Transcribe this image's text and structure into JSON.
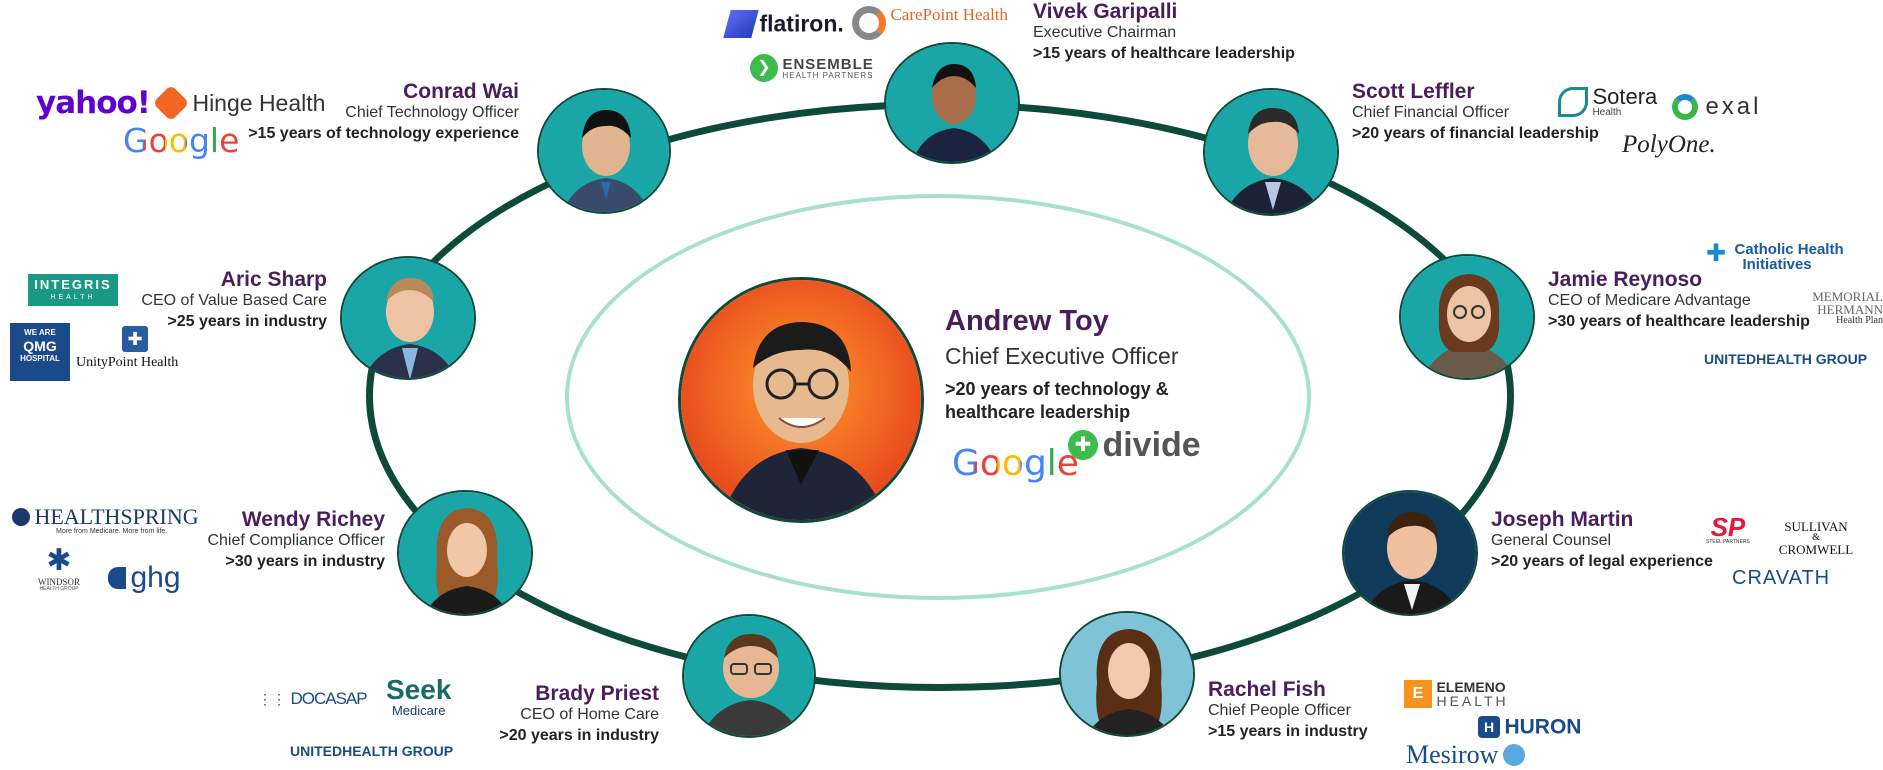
{
  "ceo": {
    "name": "Andrew Toy",
    "title": "Chief Executive Officer",
    "experience_line1": ">20 years of technology &",
    "experience_line2": "healthcare leadership",
    "logos": [
      "Google",
      "divide"
    ]
  },
  "people": [
    {
      "name": "Vivek Garipalli",
      "title": "Executive Chairman",
      "experience": ">15 years of healthcare leadership",
      "logos": [
        "flatiron.",
        "CarePoint Health",
        "ENSEMBLE",
        "HEALTH PARTNERS"
      ]
    },
    {
      "name": "Conrad Wai",
      "title": "Chief Technology Officer",
      "experience": ">15 years of technology experience",
      "logos": [
        "yahoo!",
        "Hinge Health",
        "Google"
      ]
    },
    {
      "name": "Scott Leffler",
      "title": "Chief Financial Officer",
      "experience": ">20 years of financial leadership",
      "logos": [
        "Sotera",
        "Health",
        "exal",
        "PolyOne."
      ]
    },
    {
      "name": "Aric Sharp",
      "title": "CEO of Value Based Care",
      "experience": ">25 years in industry",
      "logos": [
        "INTEGRIS",
        "HEALTH",
        "WE ARE",
        "QMG",
        "HOSPITAL",
        "UnityPoint Health"
      ]
    },
    {
      "name": "Jamie Reynoso",
      "title": "CEO of Medicare Advantage",
      "experience": ">30 years of healthcare leadership",
      "logos": [
        "Catholic Health",
        "Initiatives",
        "MEMORIAL",
        "HERMANN",
        "Health Plan",
        "UNITEDHEALTH GROUP"
      ]
    },
    {
      "name": "Wendy Richey",
      "title": "Chief Compliance Officer",
      "experience": ">30 years in industry",
      "logos": [
        "HEALTHSPRING",
        "More from Medicare. More from life.",
        "WINDSOR",
        "HEALTH GROUP",
        "ghg"
      ]
    },
    {
      "name": "Joseph Martin",
      "title": "General Counsel",
      "experience": ">20 years of legal experience",
      "logos": [
        "SP",
        "STEEL PARTNERS",
        "SULLIVAN",
        "&",
        "CROMWELL",
        "CRAVATH"
      ]
    },
    {
      "name": "Brady Priest",
      "title": "CEO of Home Care",
      "experience": ">20 years in industry",
      "logos": [
        "DOCASAP",
        "Seek",
        "Medicare",
        "UNITEDHEALTH GROUP"
      ]
    },
    {
      "name": "Rachel Fish",
      "title": "Chief People Officer",
      "experience": ">15 years in industry",
      "logos": [
        "ELEMENO",
        "HEALTH",
        "HURON",
        "Mesirow"
      ]
    }
  ],
  "colors": {
    "ring": "#0d4a3a",
    "inner_ring": "#a8e0d0",
    "name": "#4a1e5c",
    "avatar_bg": "#1aa6a6",
    "ceo_bg": "#f26a1b"
  }
}
